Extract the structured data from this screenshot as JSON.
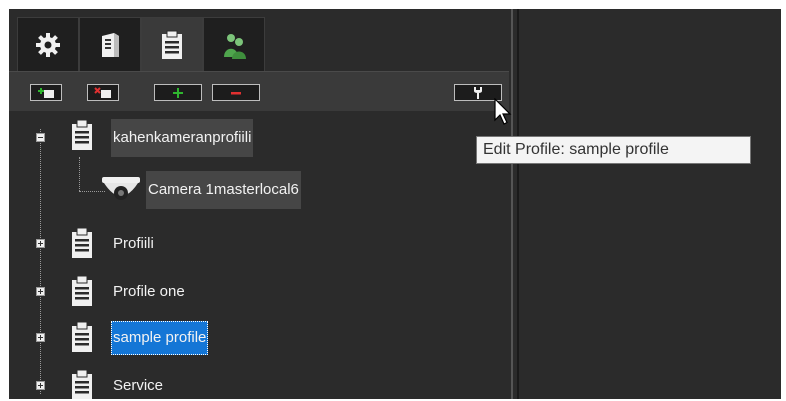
{
  "tabs": [
    {
      "icon": "gear-icon",
      "active": false
    },
    {
      "icon": "server-icon",
      "active": false
    },
    {
      "icon": "clipboard-profile-icon",
      "active": true
    },
    {
      "icon": "users-icon",
      "active": false
    }
  ],
  "toolbar": {
    "buttons": [
      "add-profile-icon",
      "delete-profile-icon",
      "add-camera-icon",
      "remove-camera-icon",
      "edit-profile-icon"
    ]
  },
  "tree": {
    "nodes": [
      {
        "label": "kahenkameranprofiili",
        "expanded": true
      },
      {
        "label": "Camera 1masterlocal6",
        "child": true
      },
      {
        "label": "Profiili",
        "expanded": false
      },
      {
        "label": "Profile one",
        "expanded": false
      },
      {
        "label": "sample profile",
        "expanded": false,
        "selected": true
      },
      {
        "label": "Service",
        "expanded": false
      }
    ]
  },
  "tooltip": {
    "text": "Edit Profile: sample profile"
  },
  "colors": {
    "background": "#2b2b2b",
    "selection": "#1476d6",
    "add": "#2fb52f",
    "remove": "#e03030"
  }
}
